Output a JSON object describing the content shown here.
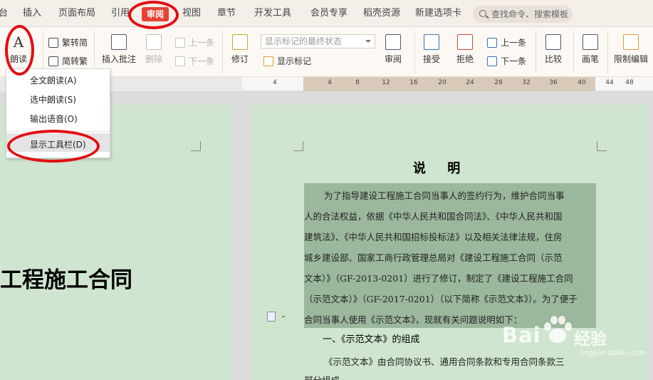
{
  "menubar": {
    "items": [
      {
        "label": "台"
      },
      {
        "label": "插入"
      },
      {
        "label": "页面布局"
      },
      {
        "label": "引用"
      },
      {
        "label": "审阅"
      },
      {
        "label": "视图"
      },
      {
        "label": "章节"
      },
      {
        "label": "开发工具"
      },
      {
        "label": "会员专享"
      },
      {
        "label": "稻壳资源"
      },
      {
        "label": "新建选项卡"
      }
    ],
    "search_placeholder": "查找命令、搜索模板"
  },
  "ribbon": {
    "read_aloud": "朗读",
    "trad_conv": "繁转简",
    "simp_conv": "简转繁",
    "insert_comment": "插入批注",
    "delete": "删除",
    "prev_comment": "上一条",
    "next_comment": "下一条",
    "revise": "修订",
    "markup_select": "显示标记的最终状态",
    "show_markup": "显示标记",
    "review": "审阅",
    "accept": "接受",
    "reject": "拒绝",
    "prev_change": "上一条",
    "next_change": "下一条",
    "compare": "比较",
    "pen": "画笔",
    "restrict_edit": "限制编辑"
  },
  "ruler": {
    "ticks": [
      "4",
      "4",
      "8",
      "12",
      "16",
      "20",
      "24",
      "28",
      "32",
      "36",
      "40",
      "44",
      "48"
    ]
  },
  "read_menu": {
    "items": [
      "全文朗读(A)",
      "选中朗读(S)",
      "输出语音(O)",
      "显示工具栏(D)"
    ]
  },
  "document": {
    "cover_title": "工程施工合同",
    "section_title": "说 明",
    "lines": [
      "为了指导建设工程施工合同当事人的签约行为，维护合同当事",
      "人的合法权益，依据《中华人民共和国合同法》、《中华人民共和国",
      "建筑法》、《中华人民共和国招标投标法》以及相关法律法规，住房",
      "城乡建设部、国家工商行政管理总局对《建设工程施工合同（示范",
      "文本）》（GF-2013-0201）进行了修订，制定了《建设工程施工合同",
      "（示范文本）》（GF-2017-0201）（以下简称《示范文本》）。为了便于",
      "合同当事人使用《示范文本》，现就有关问题说明如下："
    ],
    "heading1": "一、《示范文本》的组成",
    "para2": "《示范文本》由合同协议书、通用合同条款和专用合同条款三",
    "para2b": "部分组成。"
  },
  "watermark": {
    "brand": "Bai",
    "brand_cn": "经验",
    "url": "jingyan.baidu.com"
  },
  "colors": {
    "accent": "#e64236",
    "highlight_ring": "#e30d12",
    "page_bg": "#cfe5cf",
    "selection": "#9bb89c"
  }
}
